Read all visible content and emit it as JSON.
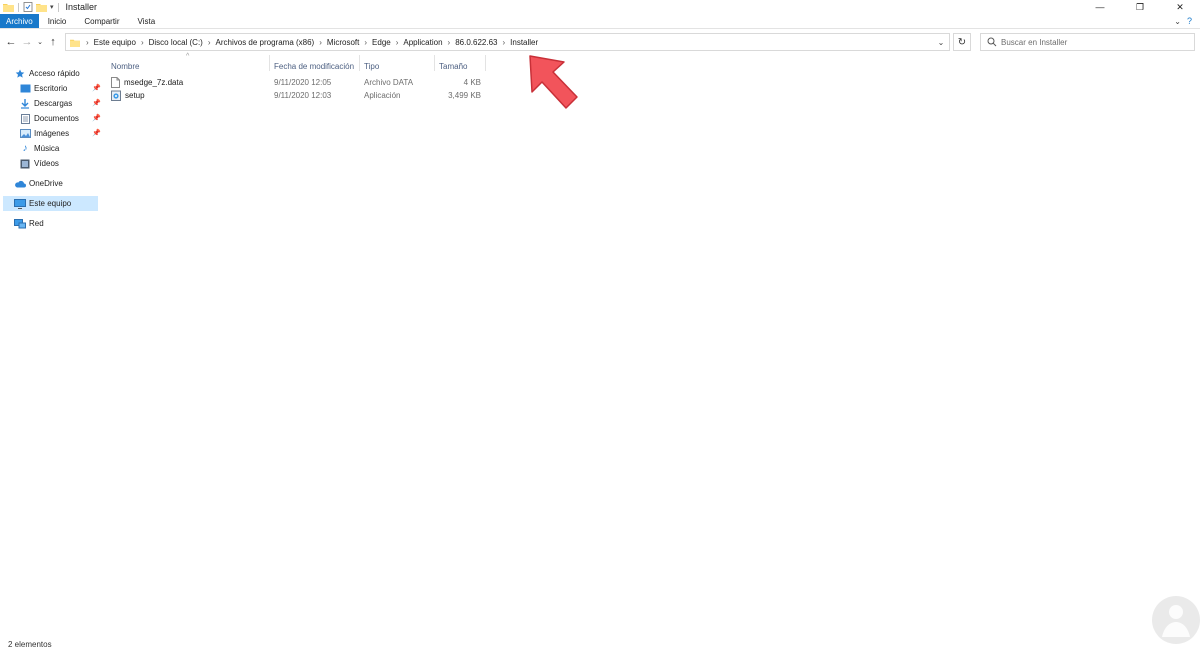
{
  "window": {
    "title": "Installer"
  },
  "ribbon": {
    "tabs": [
      {
        "label": "Archivo"
      },
      {
        "label": "Inicio"
      },
      {
        "label": "Compartir"
      },
      {
        "label": "Vista"
      }
    ]
  },
  "address": {
    "crumbs": [
      "Este equipo",
      "Disco local (C:)",
      "Archivos de programa (x86)",
      "Microsoft",
      "Edge",
      "Application",
      "86.0.622.63",
      "Installer"
    ]
  },
  "search": {
    "placeholder": "Buscar en Installer"
  },
  "sidebar": {
    "items": [
      {
        "label": "Acceso rápido"
      },
      {
        "label": "Escritorio"
      },
      {
        "label": "Descargas"
      },
      {
        "label": "Documentos"
      },
      {
        "label": "Imágenes"
      },
      {
        "label": "Música"
      },
      {
        "label": "Vídeos"
      },
      {
        "label": "OneDrive"
      },
      {
        "label": "Este equipo"
      },
      {
        "label": "Red"
      }
    ]
  },
  "columns": {
    "name": "Nombre",
    "modified": "Fecha de modificación",
    "type": "Tipo",
    "size": "Tamaño"
  },
  "files": [
    {
      "name": "msedge_7z.data",
      "modified": "9/11/2020 12:05",
      "type": "Archivo DATA",
      "size": "4 KB"
    },
    {
      "name": "setup",
      "modified": "9/11/2020 12:03",
      "type": "Aplicación",
      "size": "3,499 KB"
    }
  ],
  "status": {
    "count": "2 elementos"
  },
  "colors": {
    "accent": "#1979ca",
    "selection": "#cce8ff",
    "annotation": "#f2545b"
  }
}
